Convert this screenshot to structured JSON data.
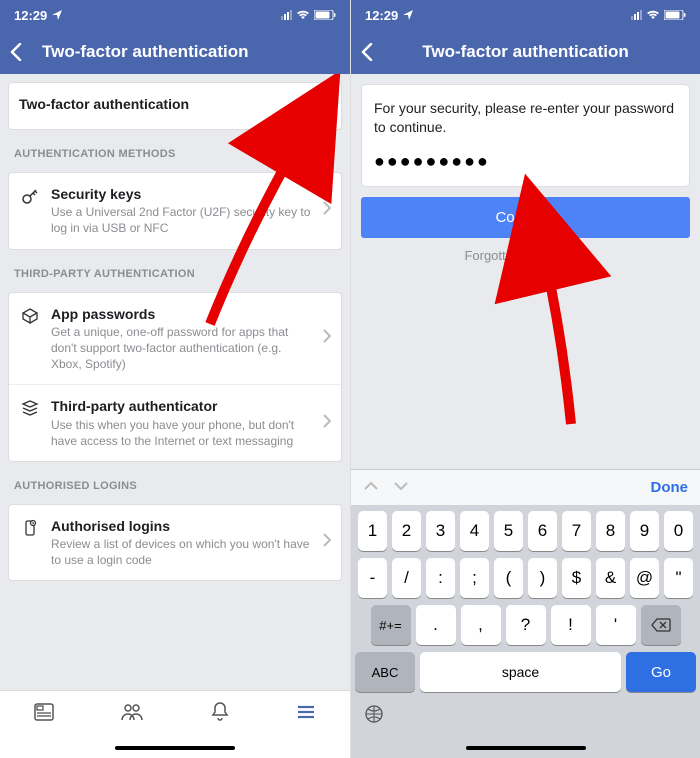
{
  "statusbar": {
    "time": "12:29"
  },
  "left": {
    "title": "Two-factor authentication",
    "toggle": {
      "label": "Two-factor authentication"
    },
    "section_methods": "AUTHENTICATION METHODS",
    "security_keys": {
      "title": "Security keys",
      "subtitle": "Use a Universal 2nd Factor (U2F) security key to log in via USB or NFC"
    },
    "section_third": "THIRD-PARTY AUTHENTICATION",
    "app_passwords": {
      "title": "App passwords",
      "subtitle": "Get a unique, one-off password for apps that don't support two-factor authentication (e.g. Xbox, Spotify)"
    },
    "third_party": {
      "title": "Third-party authenticator",
      "subtitle": "Use this when you have your phone, but don't have access to the Internet or text messaging"
    },
    "section_auth": "AUTHORISED LOGINS",
    "auth_logins": {
      "title": "Authorised logins",
      "subtitle": "Review a list of devices on which you won't have to use a login code"
    }
  },
  "right": {
    "title": "Two-factor authentication",
    "message": "For your security, please re-enter your password to continue.",
    "password_mask": "●●●●●●●●●",
    "continue": "Continue",
    "forgot": "Forgotten password?",
    "done": "Done",
    "keys_row1": [
      "1",
      "2",
      "3",
      "4",
      "5",
      "6",
      "7",
      "8",
      "9",
      "0"
    ],
    "keys_row2": [
      "-",
      "/",
      ":",
      ";",
      "(",
      ")",
      "$",
      "&",
      "@",
      "\""
    ],
    "keys_row3_shift": "#+=",
    "keys_row3": [
      ".",
      ",",
      "?",
      "!",
      "'"
    ],
    "abc": "ABC",
    "space": "space",
    "go": "Go"
  }
}
